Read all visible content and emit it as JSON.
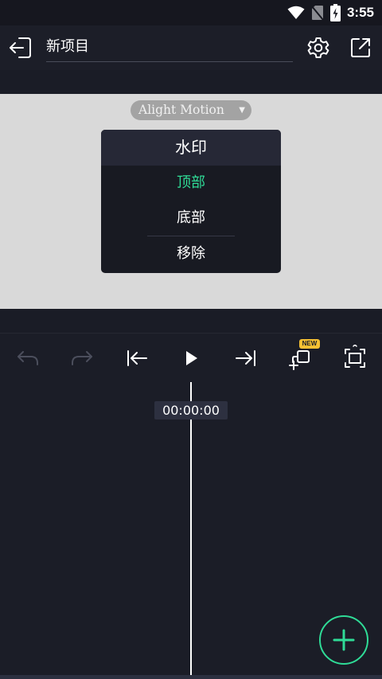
{
  "status_bar": {
    "time": "3:55",
    "icons": [
      "wifi-icon",
      "no-sim-icon",
      "battery-icon"
    ]
  },
  "app_bar": {
    "title": "新项目",
    "icons": [
      "exit-icon",
      "settings-icon",
      "export-icon"
    ]
  },
  "canvas": {
    "watermark_label": "Alight Motion",
    "watermark_menu": {
      "header": "水印",
      "items": [
        {
          "label": "顶部",
          "selected": true
        },
        {
          "label": "底部",
          "selected": false
        },
        {
          "label": "移除",
          "selected": false
        }
      ]
    }
  },
  "toolbar": {
    "icons": [
      "undo-icon",
      "redo-icon",
      "skip-to-start-icon",
      "play-icon",
      "skip-to-end-icon",
      "new-layer-icon",
      "fit-screen-icon"
    ],
    "new_badge": "NEW"
  },
  "timeline": {
    "timecode": "00:00:00"
  },
  "fab": {
    "icon": "plus-icon"
  },
  "colors": {
    "accent": "#2fdc97",
    "background": "#1b1d27",
    "canvas": "#d9d9d9",
    "badge": "#f6c033"
  }
}
